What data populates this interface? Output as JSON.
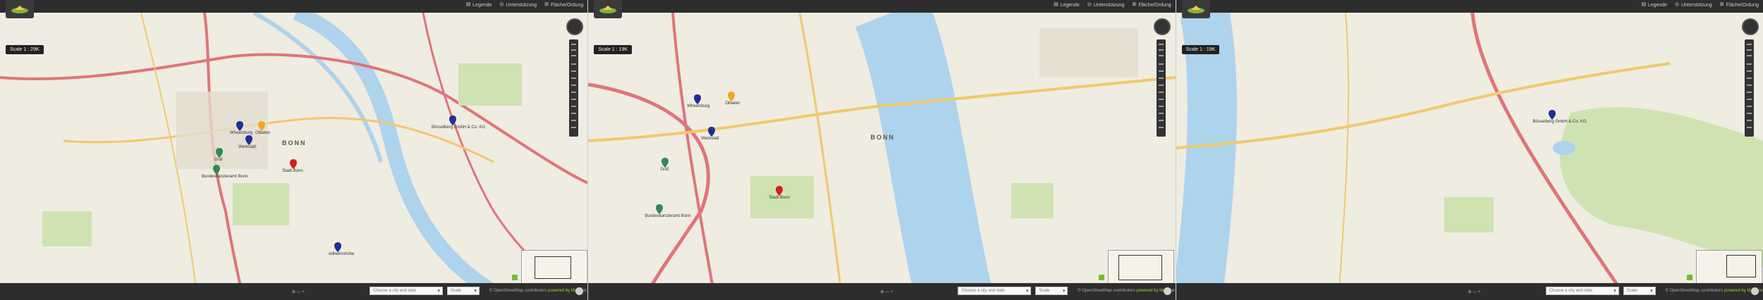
{
  "header": {
    "links": [
      "Legende",
      "Unterstützung",
      "Fläche/Ordung"
    ],
    "link_icons": [
      "legend-icon",
      "help-icon",
      "area-icon"
    ]
  },
  "panels": [
    {
      "scale_label": "Scale 1 : 29K",
      "city_label": "BONN",
      "pins": [
        {
          "label": "Wheelsburg",
          "color": "#1f2e9a"
        },
        {
          "label": "Oblaten",
          "color": "#f2a81d"
        },
        {
          "label": "Werkstatt",
          "color": "#1f2e9a"
        },
        {
          "label": "Gräf",
          "color": "#2e8b57"
        },
        {
          "label": "Bundeskanzleramt Bonn",
          "color": "#2e8b57"
        },
        {
          "label": "Stadt Bonn",
          "color": "#d61e1e"
        },
        {
          "label": "Bösselberg GmbH & Co. KG",
          "color": "#1f2e9a"
        },
        {
          "label": "wilhelmshöhe",
          "color": "#1f2e9a"
        }
      ],
      "bottom": {
        "coords": "⊕ — +",
        "select_left": "Choose a city and date",
        "select_right": "Scale",
        "credits": "© OpenStreetMap contributors",
        "powered": "powered by MapBox"
      }
    },
    {
      "scale_label": "Scale 1 : 19K",
      "city_label": "BONN",
      "pins": [
        {
          "label": "Wheelsburg",
          "color": "#1f2e9a"
        },
        {
          "label": "Oblaten",
          "color": "#f2a81d"
        },
        {
          "label": "Werkstatt",
          "color": "#1f2e9a"
        },
        {
          "label": "Gräf",
          "color": "#2e8b57"
        },
        {
          "label": "Bundeskanzleramt Bonn",
          "color": "#2e8b57"
        },
        {
          "label": "Stadt Bonn",
          "color": "#d61e1e"
        }
      ],
      "bottom": {
        "coords": "⊕ — +",
        "select_left": "Choose a city and date",
        "select_right": "Scale",
        "credits": "© OpenStreetMap contributors",
        "powered": "powered by MapBox"
      }
    },
    {
      "scale_label": "Scale 1 : 19K",
      "city_label": "",
      "pins": [
        {
          "label": "Bösselberg GmbH & Co. KG",
          "color": "#1f2e9a"
        }
      ],
      "bottom": {
        "coords": "⊕ — +",
        "select_left": "Choose a city and date",
        "select_right": "Scale",
        "credits": "© OpenStreetMap contributors",
        "powered": "powered by MapBox"
      }
    }
  ],
  "colors": {
    "river": "#aed3ec",
    "motorway": "#e0747a",
    "primary": "#f1c96b",
    "park": "#cfe3b2",
    "topbar": "#2d2d2d",
    "accent": "#9bd14a"
  }
}
